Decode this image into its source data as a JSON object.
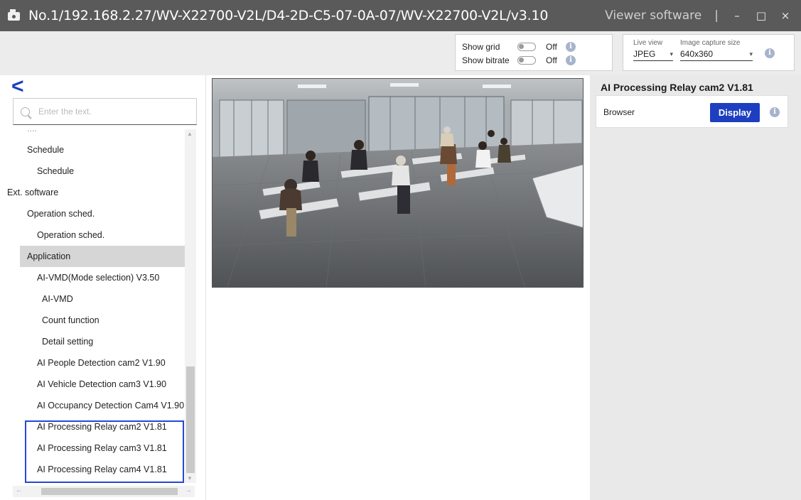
{
  "titlebar": {
    "title": "No.1/192.168.2.27/WV-X22700-V2L/D4-2D-C5-07-0A-07/WV-X22700-V2L/v3.10",
    "app_name": "Viewer software",
    "separator": "|",
    "minimize": "–",
    "maximize": "□",
    "close": "×"
  },
  "toolbar": {
    "show_grid_label": "Show grid",
    "show_grid_state": "Off",
    "show_bitrate_label": "Show bitrate",
    "show_bitrate_state": "Off",
    "info": "i",
    "live_view_label": "Live view",
    "live_view_value": "JPEG",
    "capture_size_label": "Image capture size",
    "capture_size_value": "640x360",
    "dropdown_arrow": "▾"
  },
  "left": {
    "back": "<",
    "search_placeholder": "Enter the text.",
    "truncated_item": "....",
    "items": [
      "Schedule",
      "Schedule",
      "Ext. software",
      "Operation sched.",
      "Operation sched.",
      "Application",
      "AI-VMD(Mode selection) V3.50",
      "AI-VMD",
      "Count function",
      "Detail setting",
      "AI People Detection cam2 V1.90",
      "AI Vehicle Detection cam3 V1.90",
      "AI Occupancy Detection Cam4 V1.90",
      "AI Processing Relay cam2 V1.81",
      "AI Processing Relay cam3 V1.81",
      "AI Processing Relay cam4 V1.81"
    ],
    "scroll_up": "▲",
    "scroll_down": "▼",
    "scroll_left": "←",
    "scroll_right": "→"
  },
  "right": {
    "title": "AI Processing Relay cam2 V1.81",
    "browser_label": "Browser",
    "display_button": "Display",
    "info": "i"
  },
  "colors": {
    "accent": "#1d3fbf",
    "highlight_border": "#2448d6",
    "titlebar": "#5a5a5a"
  }
}
